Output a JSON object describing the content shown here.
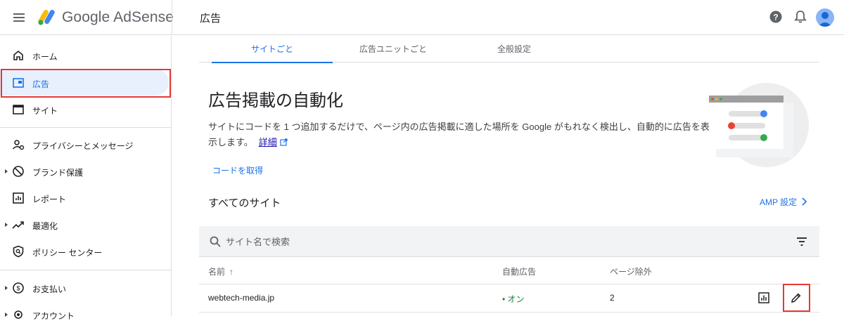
{
  "topbar": {
    "brand_google": "Google",
    "brand_product": "AdSense",
    "page_title": "広告",
    "icons": [
      "menu-icon",
      "help-icon",
      "bell-icon",
      "avatar"
    ]
  },
  "sidebar": {
    "items": [
      {
        "label": "ホーム",
        "icon": "home-icon"
      },
      {
        "label": "広告",
        "icon": "ads-icon",
        "active": true
      },
      {
        "label": "サイト",
        "icon": "sites-icon"
      },
      {
        "label": "プライバシーとメッセージ",
        "icon": "privacy-icon"
      },
      {
        "label": "ブランド保護",
        "icon": "block-icon",
        "expandable": true
      },
      {
        "label": "レポート",
        "icon": "report-icon"
      },
      {
        "label": "最適化",
        "icon": "trending-icon",
        "expandable": true
      },
      {
        "label": "ポリシー センター",
        "icon": "policy-icon"
      },
      {
        "label": "お支払い",
        "icon": "payments-icon",
        "expandable": true
      },
      {
        "label": "アカウント",
        "icon": "account-gear-icon",
        "expandable": true
      }
    ]
  },
  "tabs": [
    {
      "label": "サイトごと",
      "active": true
    },
    {
      "label": "広告ユニットごと"
    },
    {
      "label": "全般設定"
    }
  ],
  "hero": {
    "title": "広告掲載の自動化",
    "description": "サイトにコードを 1 つ追加するだけで、ページ内の広告掲載に適した場所を Google がもれなく検出し、自動的に広告を表示します。",
    "learn_more": "詳細",
    "get_code": "コードを取得"
  },
  "sites": {
    "heading": "すべてのサイト",
    "amp_settings": "AMP 設定",
    "search_placeholder": "サイト名で検索",
    "columns": {
      "name": "名前",
      "sort_indicator": "↑",
      "auto_ads": "自動広告",
      "page_exclusions": "ページ除外"
    },
    "rows": [
      {
        "name": "webtech-media.jp",
        "auto_ads_dot": "•",
        "auto_ads": "オン",
        "page_exclusions": "2"
      }
    ]
  },
  "colors": {
    "accent": "#1a73e8",
    "active_bg": "#e8f0fe",
    "highlight_border": "#e53935",
    "status_on": "#188038"
  }
}
